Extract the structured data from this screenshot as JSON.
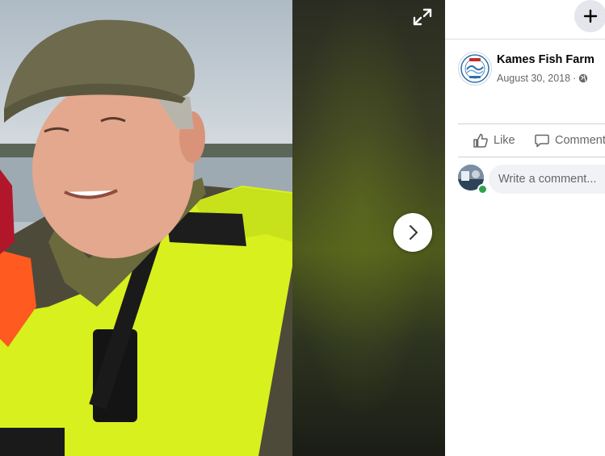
{
  "viewer": {
    "expand_icon": "expand-icon",
    "next_icon": "chevron-right-icon"
  },
  "panel": {
    "add_icon": "plus-icon",
    "post": {
      "page_name": "Kames Fish Farm",
      "date": "August 30, 2018",
      "separator": "·",
      "privacy_icon": "globe-icon",
      "avatar_logo_text": [
        "KAMES",
        "SCOTLAND"
      ]
    },
    "actions": {
      "like_label": "Like",
      "comment_label": "Comment"
    },
    "comment_box": {
      "placeholder": "Write a comment..."
    }
  },
  "colors": {
    "panel_bg": "#ffffff",
    "text_primary": "#050505",
    "text_secondary": "#65676b",
    "button_bg": "#e4e6eb",
    "input_bg": "#f0f2f5",
    "online": "#31a24c",
    "vest": "#d8f01e"
  }
}
